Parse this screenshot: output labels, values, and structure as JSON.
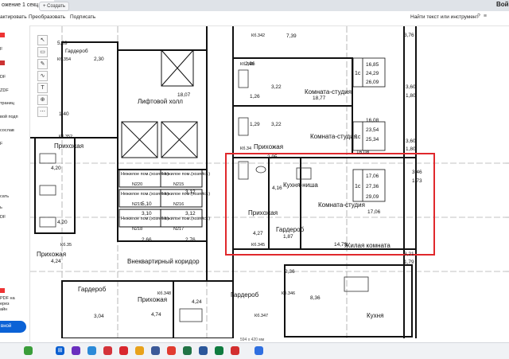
{
  "tab": {
    "title": "ожение 1 секц...",
    "new_tab": "Создать"
  },
  "account": "Вой",
  "toolbar": {
    "items": [
      "актировать",
      "Преобразовать",
      "Подписать"
    ],
    "search": "Найти текст или инструмент"
  },
  "sidebar": {
    "items": [
      "F",
      "DF",
      "ZDF",
      "траниц",
      "вой подп",
      "сослав",
      "F",
      "сать",
      "ь",
      "DF"
    ],
    "bottom_text": [
      "PDF на",
      "ерез",
      "айн"
    ],
    "button": "вной"
  },
  "plan": {
    "area_labels": [
      "5,39",
      "2,30",
      "Гардероб",
      "7,39",
      "2,96",
      "16,85",
      "24,29",
      "26,09",
      "3,76",
      "18,77",
      "3,60",
      "1,80",
      "18,07",
      "3,22",
      "1,26",
      "1,29",
      "3,22",
      "16,08",
      "23,54",
      "25,34",
      "1,80",
      "3,60",
      "1,40",
      "2,95",
      "16,08",
      "4,16",
      "17,06",
      "27,36",
      "29,09",
      "3,46",
      "1,73",
      "4,20",
      "4,20",
      "5,10",
      "3,12",
      "3,10",
      "3,12",
      "2,66",
      "2,76",
      "4,27",
      "1,87",
      "17,06",
      "4,24",
      "14,79",
      "1,79",
      "3,21",
      "2,36",
      "8,36",
      "4,24",
      "3,04",
      "4,74"
    ],
    "room_labels": [
      "Прихожая",
      "Лифтовой холл",
      "Комната-студия",
      "Комната-студия",
      "Прихожая",
      "Кухня-ниша",
      "Прихожая",
      "Комната-студия",
      "Гардероб",
      "Жилая комната",
      "Внеквартирный коридор",
      "Гардероб",
      "Прихожая",
      "Прихожая",
      "Кухня",
      "Гардероб"
    ],
    "storage": [
      {
        "name": "Нежилое пом.(хозяйст.)",
        "num": "N220"
      },
      {
        "name": "Нежилое пом.(хозяйст.)",
        "num": "N215"
      },
      {
        "name": "Нежилое пом.(хозяйст.)",
        "num": "N219"
      },
      {
        "name": "Нежилое пом.(хозяйст.)",
        "num": "N216"
      },
      {
        "name": "Нежилое пом.(хозяйст.)",
        "num": "N218"
      },
      {
        "name": "Нежилое пом.(хозяйст.)",
        "num": "N217"
      }
    ],
    "apt_codes": [
      "1с",
      "1с",
      "1с"
    ],
    "room_codes": [
      "Кб.354",
      "Кб.342",
      "Кб.343",
      "Кб.352",
      "Кб.34",
      "Кб.345",
      "Кб.35",
      "Кб.346",
      "Кб.348",
      "Кб.347"
    ],
    "highlight_color": "#e0282c"
  },
  "status": {
    "page_size": "594 x 420 мм"
  }
}
